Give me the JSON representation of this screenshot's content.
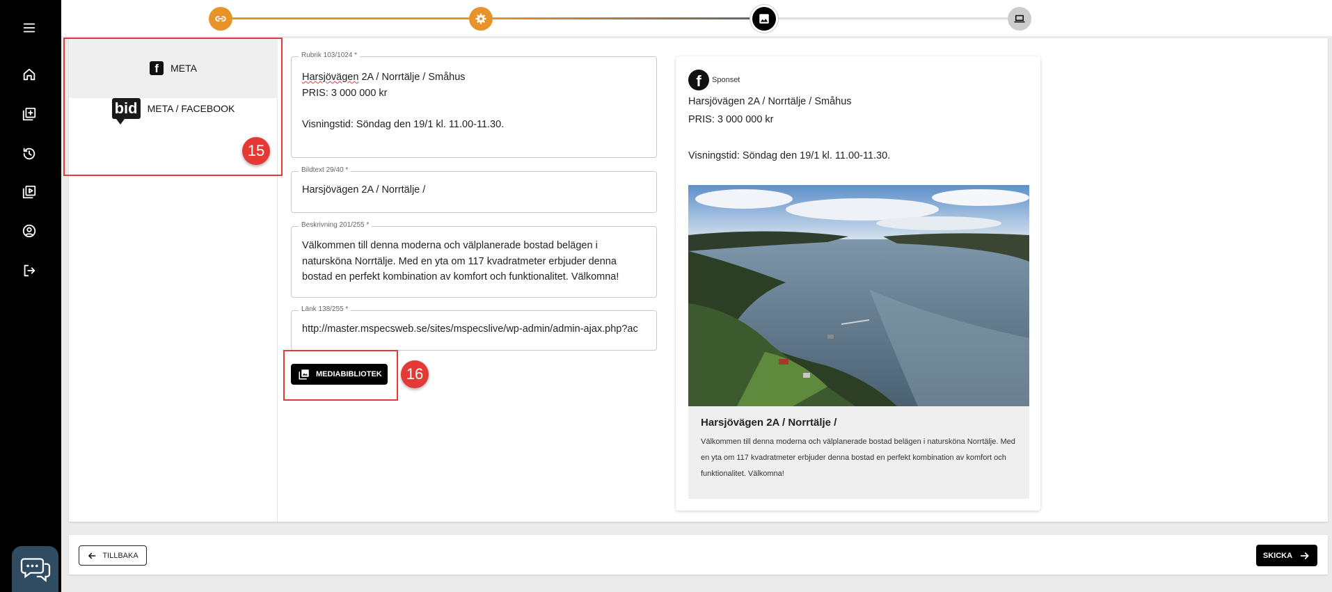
{
  "sidebar": {
    "items": [
      {
        "icon": "menu-icon"
      },
      {
        "icon": "home-icon"
      },
      {
        "icon": "add-library-icon"
      },
      {
        "icon": "history-icon"
      },
      {
        "icon": "video-library-icon"
      },
      {
        "icon": "account-icon"
      },
      {
        "icon": "logout-icon"
      }
    ],
    "chat_icon": "chat-bubbles-icon"
  },
  "stepper": {
    "steps": [
      {
        "icon": "link-icon",
        "state": "done",
        "color": "#e8922a"
      },
      {
        "icon": "gear-icon",
        "state": "done",
        "color": "#e8922a"
      },
      {
        "icon": "image-icon",
        "state": "active",
        "color": "#000000"
      },
      {
        "icon": "laptop-icon",
        "state": "pending",
        "color": "#cccccc"
      }
    ]
  },
  "channels": {
    "items": [
      {
        "label": "META",
        "active": true
      },
      {
        "label": "META / FACEBOOK",
        "logo": "bid",
        "active": false
      }
    ]
  },
  "annotations": {
    "badge_15": "15",
    "badge_16": "16"
  },
  "form": {
    "rubrik": {
      "label": "Rubrik 103/1024 *",
      "value_first_word": "Harsjövägen",
      "value_rest": " 2A / Norrtälje / Småhus\nPRIS: 3 000 000 kr\n\nVisningstid: Söndag den 19/1 kl. 11.00-11.30."
    },
    "bildtext": {
      "label": "Bildtext 29/40 *",
      "value": "Harsjövägen 2A / Norrtälje /"
    },
    "beskrivning": {
      "label": "Beskrivning 201/255 *",
      "value": "Välkommen till denna moderna och välplanerade bostad belägen i natursköna Norrtälje. Med en yta om 117 kvadratmeter erbjuder denna bostad en perfekt kombination av komfort och funktionalitet. Välkomna!"
    },
    "lank": {
      "label": "Länk 138/255 *",
      "value": "http://master.mspecsweb.se/sites/mspecslive/wp-admin/admin-ajax.php?ac"
    },
    "media_button": "MEDIABIBLIOTEK"
  },
  "preview": {
    "sponsored": "Sponset",
    "text": "Harsjövägen 2A / Norrtälje / Småhus\nPRIS: 3 000 000 kr\n\nVisningstid: Söndag den 19/1 kl. 11.00-11.30.",
    "card_title": "Harsjövägen 2A / Norrtälje /",
    "card_desc": "Välkommen till denna moderna och välplanerade bostad belägen i natursköna Norrtälje. Med en yta om 117 kvadratmeter erbjuder denna bostad en perfekt kombination av komfort och funktionalitet. Välkomna!"
  },
  "footer": {
    "back": "TILLBAKA",
    "send": "SKICKA"
  },
  "colors": {
    "accent": "#e8922a",
    "highlight": "#e53935",
    "sidebar": "#000000"
  }
}
